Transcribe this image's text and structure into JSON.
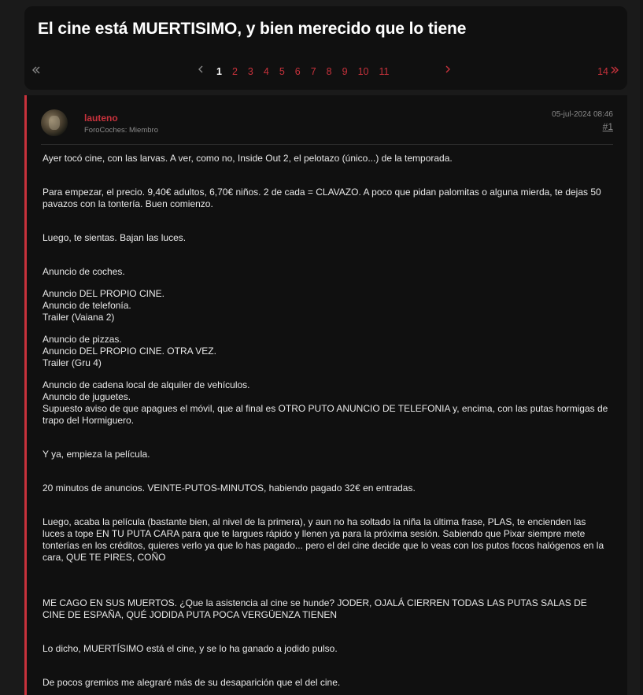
{
  "thread": {
    "title": "El cine está MUERTISIMO, y bien merecido que lo tiene"
  },
  "pagination": {
    "first_icon": "double-chevron-left-icon",
    "prev_icon": "chevron-left-icon",
    "next_icon": "chevron-right-icon",
    "pages": [
      "1",
      "2",
      "3",
      "4",
      "5",
      "6",
      "7",
      "8",
      "9",
      "10",
      "11"
    ],
    "current_page": "1",
    "last_page": "14",
    "last_icon": "double-chevron-right-icon"
  },
  "post": {
    "username": "lauteno",
    "user_title": "ForoCoches: Miembro",
    "date": "05-jul-2024 08:46",
    "anchor": "#1",
    "paragraphs": [
      [
        "Ayer tocó cine, con las larvas. A ver, como no, Inside Out 2, el pelotazo (único...) de la temporada."
      ],
      [
        "Para empezar, el precio. 9,40€ adultos, 6,70€ niños. 2 de cada = CLAVAZO. A poco que pidan palomitas o alguna mierda, te dejas 50",
        "pavazos con la tontería. Buen comienzo."
      ],
      [
        "Luego, te sientas. Bajan las luces."
      ],
      [
        "Anuncio de coches."
      ],
      [
        "Anuncio DEL PROPIO CINE.",
        "Anuncio de telefonía.",
        "Trailer (Vaiana 2)"
      ],
      [
        "Anuncio de pizzas.",
        "Anuncio DEL PROPIO CINE. OTRA VEZ.",
        "Trailer (Gru 4)"
      ],
      [
        "Anuncio de cadena local de alquiler de vehículos.",
        "Anuncio de juguetes.",
        "Supuesto aviso de que apagues el móvil, que al final es OTRO PUTO ANUNCIO DE TELEFONIA y, encima, con las putas hormigas de",
        "trapo del Hormiguero."
      ],
      [
        "Y ya, empieza la película."
      ],
      [
        "20 minutos de anuncios. VEINTE-PUTOS-MINUTOS, habiendo pagado 32€ en entradas."
      ],
      [
        "Luego, acaba la película (bastante bien, al nivel de la primera), y aun no ha soltado la niña la última frase, PLAS, te encienden las",
        "luces a tope EN TU PUTA CARA para que te largues rápido y llenen ya para la próxima sesión. Sabiendo que Pixar siempre mete",
        "tonterías en los créditos, quieres verlo ya que lo has pagado... pero el del cine decide que lo veas con los putos focos halógenos en la",
        "cara, QUE TE PIRES, COÑO"
      ],
      [
        "ME CAGO EN SUS MUERTOS. ¿Que la asistencia al cine se hunde? JODER, OJALÁ CIERREN TODAS LAS PUTAS SALAS DE",
        "CINE DE ESPAÑA, QUÉ JODIDA PUTA POCA VERGÜENZA TIENEN"
      ],
      [
        "Lo dicho, MUERTÍSIMO está el cine, y se lo ha ganado a jodido pulso."
      ],
      [
        "De pocos gremios me alegraré más de su desaparición que el del cine."
      ]
    ]
  },
  "colors": {
    "accent": "#c8323c",
    "panel": "#101010",
    "background": "#1a1a1a"
  }
}
